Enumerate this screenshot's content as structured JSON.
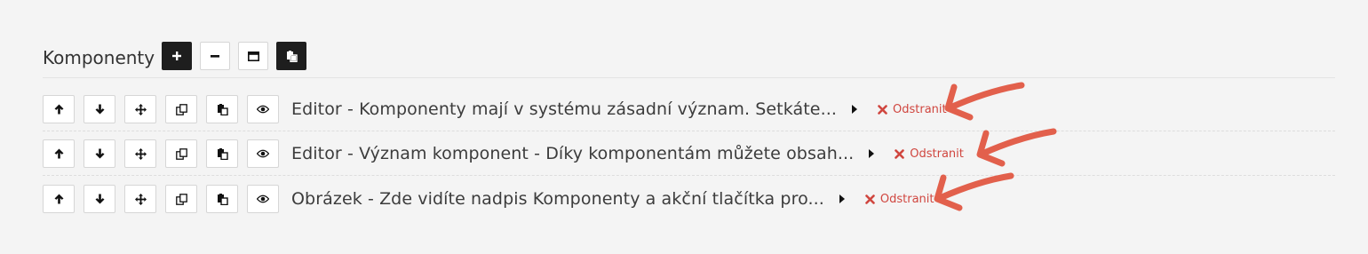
{
  "section": {
    "title": "Komponenty",
    "header_buttons": [
      {
        "icon": "plus-icon",
        "style": "dark"
      },
      {
        "icon": "minus-icon",
        "style": "light"
      },
      {
        "icon": "window-icon",
        "style": "light"
      },
      {
        "icon": "paste-icon",
        "style": "dark"
      }
    ]
  },
  "row_buttons": [
    {
      "icon": "arrow-up-icon"
    },
    {
      "icon": "arrow-down-icon"
    },
    {
      "icon": "move-icon"
    },
    {
      "icon": "duplicate-icon"
    },
    {
      "icon": "paste-icon"
    },
    {
      "icon": "eye-icon"
    }
  ],
  "components": [
    {
      "title": "Editor - Komponenty mají v systému zásadní význam. Setkáte...",
      "remove_label": "Odstranit"
    },
    {
      "title": "Editor - Význam komponent - Díky komponentám můžete obsah...",
      "remove_label": "Odstranit"
    },
    {
      "title": "Obrázek - Zde vidíte nadpis Komponenty a akční tlačítka pro...",
      "remove_label": "Odstranit"
    }
  ],
  "colors": {
    "accent_red": "#d0463f",
    "annotation_arrow": "#e2604c",
    "dark_button": "#1e1e1e"
  }
}
